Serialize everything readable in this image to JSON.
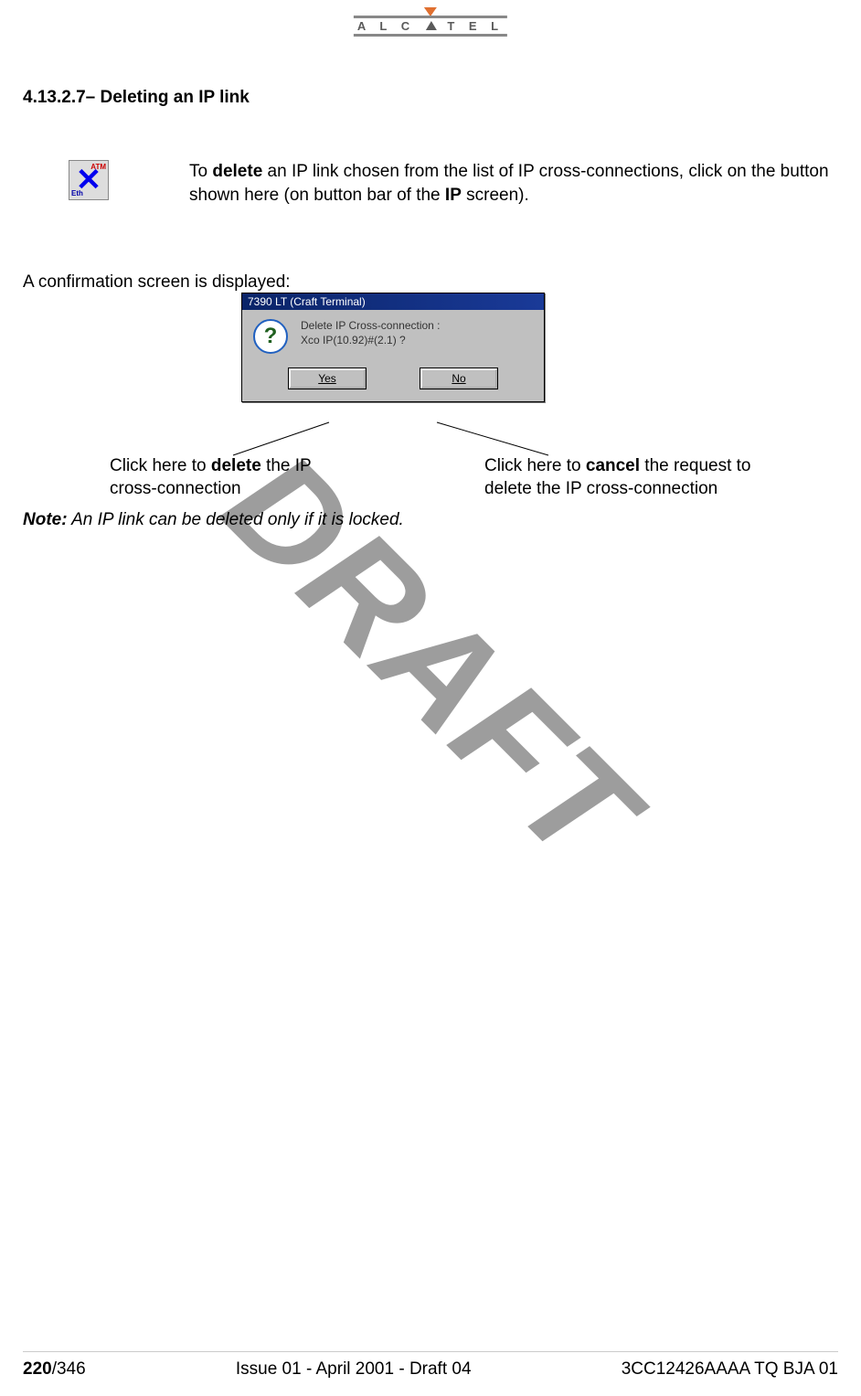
{
  "logo": {
    "text": "A L C T E L"
  },
  "heading": "4.13.2.7– Deleting an IP link",
  "intro": {
    "pre": "To ",
    "bold1": "delete",
    "mid": " an IP link chosen from the list of IP cross-connections, click on the button shown here (on button bar of the ",
    "bold2": "IP",
    "post": " screen)."
  },
  "icon_button": {
    "atm": "ATM",
    "eth": "Eth"
  },
  "confirm_intro": "A confirmation screen is displayed:",
  "dialog": {
    "title": "7390 LT (Craft Terminal)",
    "msg_line1": "Delete IP Cross-connection :",
    "msg_line2": "Xco IP(10.92)#(2.1) ?",
    "yes": "Yes",
    "no": "No"
  },
  "callout_left": {
    "pre": "Click here to ",
    "bold": "delete",
    "post": " the IP cross-connection"
  },
  "callout_right": {
    "pre": "Click here to ",
    "bold": "cancel",
    "post": " the request to delete the IP cross-connection"
  },
  "note": {
    "label": "Note:",
    "text": " An IP link can be deleted only if it is locked."
  },
  "watermark": "DRAFT",
  "footer": {
    "page_bold": "220",
    "page_total": "/346",
    "center": "Issue 01 - April 2001 - Draft 04",
    "right": "3CC12426AAAA TQ BJA 01"
  }
}
